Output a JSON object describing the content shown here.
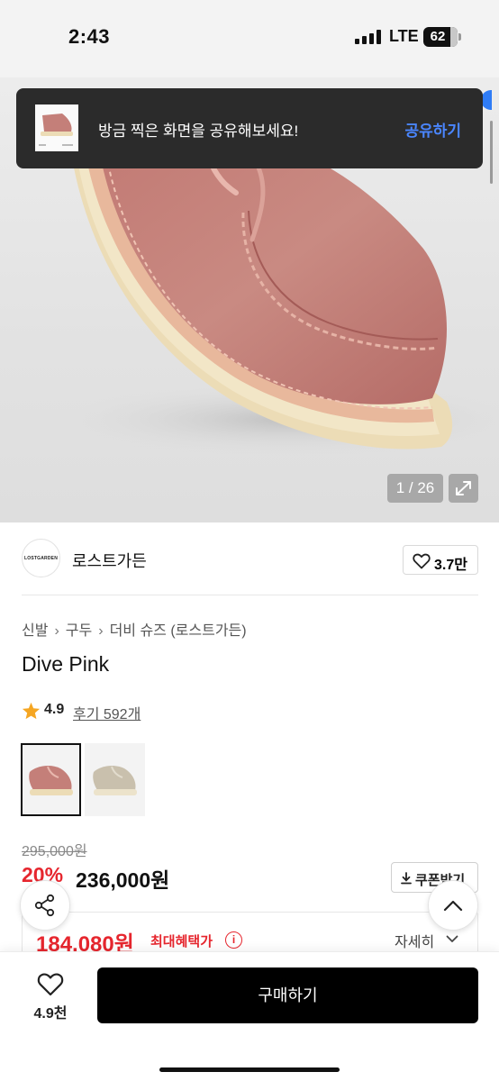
{
  "status_bar": {
    "time": "2:43",
    "network": "LTE",
    "battery": "62"
  },
  "toast": {
    "message": "방금 찍은 화면을 공유해보세요!",
    "action": "공유하기"
  },
  "gallery": {
    "counter": "1 / 26"
  },
  "brand": {
    "logo_text": "LOSTGARDEN",
    "name": "로스트가든",
    "likes": "3.7만"
  },
  "breadcrumb": [
    "신발",
    "구두",
    "더비 슈즈 (로스트가든)"
  ],
  "product": {
    "title": "Dive Pink",
    "rating": "4.9",
    "review_text": "후기 592개"
  },
  "swatches": [
    {
      "color": "#c47f79"
    },
    {
      "color": "#c9c0ad"
    }
  ],
  "pricing": {
    "original": "295,000원",
    "discount": "20%",
    "price": "236,000원",
    "coupon_label": "쿠폰받기",
    "max_benefit_price": "184,080원",
    "max_benefit_label": "최대혜택가",
    "detail_label": "자세히"
  },
  "bottom_bar": {
    "wish_count": "4.9천",
    "buy_label": "구매하기"
  },
  "colors": {
    "accent_red": "#e6262e",
    "link_blue": "#4a86ff",
    "star": "#f5a623"
  }
}
